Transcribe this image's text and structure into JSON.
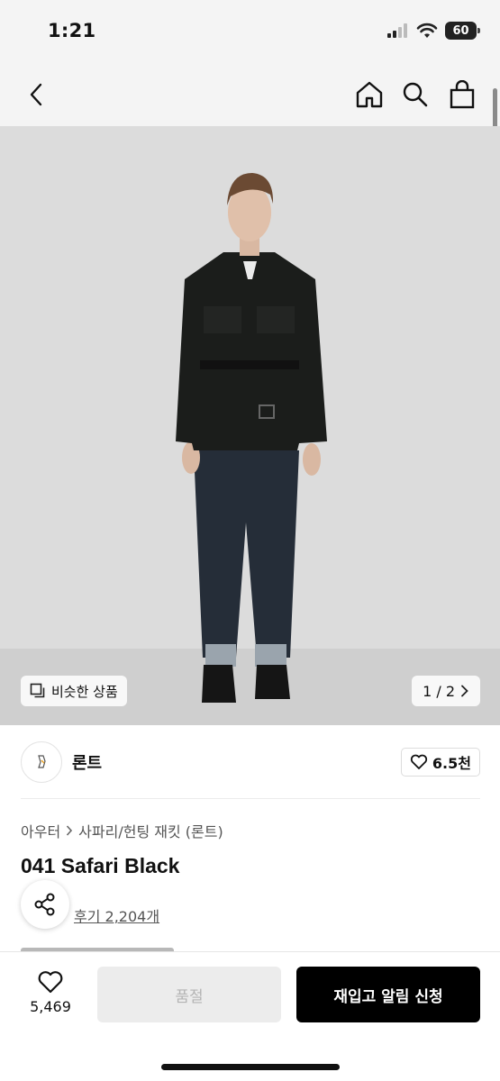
{
  "status_bar": {
    "time": "1:21",
    "battery": "60"
  },
  "nav": {
    "icons": [
      "back-icon",
      "home-icon",
      "search-icon",
      "shopping-bag-icon"
    ]
  },
  "hero": {
    "similar_label": "비슷한 상품",
    "page_indicator": "1 / 2"
  },
  "brand": {
    "name": "론트",
    "likes": "6.5천"
  },
  "product": {
    "breadcrumb": [
      "아우터",
      "사파리/헌팅 재킷 (론트)"
    ],
    "title": "041 Safari Black",
    "review_link": "후기 2,204개"
  },
  "bottom_bar": {
    "wish_count": "5,469",
    "soldout_label": "품절",
    "restock_label": "재입고 알림 신청"
  },
  "colors": {
    "accent": "#000000",
    "background": "#ffffff",
    "header_bg": "#f4f4f4"
  }
}
